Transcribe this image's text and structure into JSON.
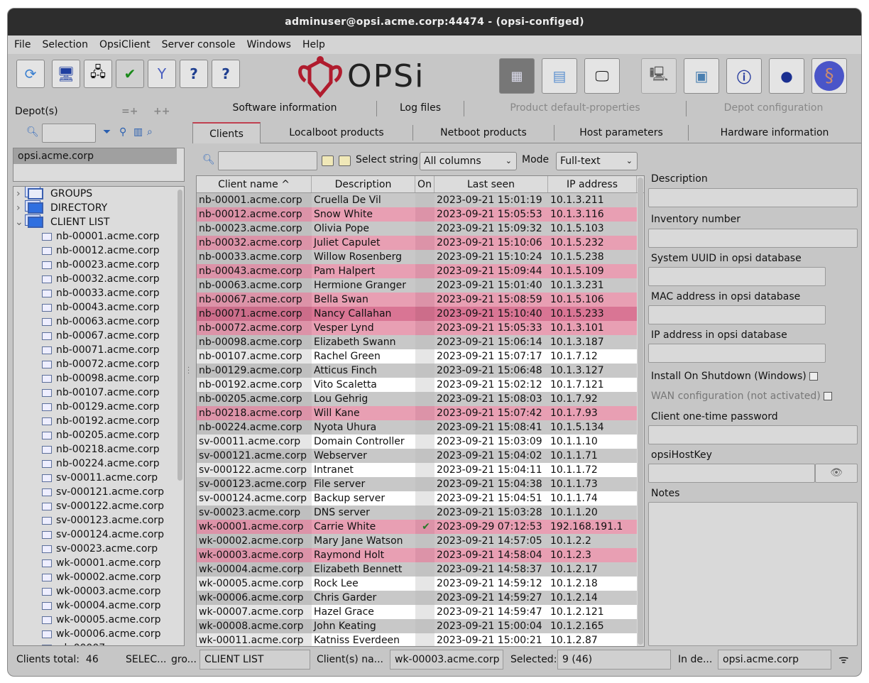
{
  "window": {
    "title": "adminuser@opsi.acme.corp:44474 - (opsi-configed)"
  },
  "menu": [
    "File",
    "Selection",
    "OpsiClient",
    "Server console",
    "Windows",
    "Help"
  ],
  "logo": "OPSi",
  "depot": {
    "label": "Depot(s)",
    "btn_a": "=+",
    "btn_b": "++",
    "selected": "opsi.acme.corp"
  },
  "tree": {
    "groups": [
      "GROUPS",
      "DIRECTORY",
      "CLIENT LIST"
    ]
  },
  "subtabs": [
    "Software information",
    "Log files",
    "Product default-properties",
    "Depot configuration"
  ],
  "tabs": [
    "Clients",
    "Localboot products",
    "Netboot products",
    "Host parameters",
    "Hardware information"
  ],
  "filter": {
    "select_label": "Select string",
    "columns": "All columns",
    "mode_label": "Mode",
    "mode": "Full-text"
  },
  "columns": [
    "Client name ^",
    "Description",
    "On",
    "Last seen",
    "IP address"
  ],
  "rows": [
    [
      "nb-00001.acme.corp",
      "Cruella De Vil",
      "",
      "2023-09-21 15:01:19",
      "10.1.3.211",
      "g"
    ],
    [
      "nb-00012.acme.corp",
      "Snow White",
      "",
      "2023-09-21 15:05:53",
      "10.1.3.116",
      "p"
    ],
    [
      "nb-00023.acme.corp",
      "Olivia Pope",
      "",
      "2023-09-21 15:09:32",
      "10.1.5.103",
      "g"
    ],
    [
      "nb-00032.acme.corp",
      "Juliet Capulet",
      "",
      "2023-09-21 15:10:06",
      "10.1.5.232",
      "p"
    ],
    [
      "nb-00033.acme.corp",
      "Willow Rosenberg",
      "",
      "2023-09-21 15:10:24",
      "10.1.5.238",
      "g"
    ],
    [
      "nb-00043.acme.corp",
      "Pam Halpert",
      "",
      "2023-09-21 15:09:44",
      "10.1.5.109",
      "p"
    ],
    [
      "nb-00063.acme.corp",
      "Hermione Granger",
      "",
      "2023-09-21 15:01:40",
      "10.1.3.231",
      "g"
    ],
    [
      "nb-00067.acme.corp",
      "Bella Swan",
      "",
      "2023-09-21 15:08:59",
      "10.1.5.106",
      "p"
    ],
    [
      "nb-00071.acme.corp",
      "Nancy Callahan",
      "",
      "2023-09-21 15:10:40",
      "10.1.5.233",
      "d"
    ],
    [
      "nb-00072.acme.corp",
      "Vesper Lynd",
      "",
      "2023-09-21 15:05:33",
      "10.1.3.101",
      "p"
    ],
    [
      "nb-00098.acme.corp",
      "Elizabeth Swann",
      "",
      "2023-09-21 15:06:14",
      "10.1.3.187",
      "g"
    ],
    [
      "nb-00107.acme.corp",
      "Rachel Green",
      "",
      "2023-09-21 15:07:17",
      "10.1.7.12",
      "w"
    ],
    [
      "nb-00129.acme.corp",
      "Atticus Finch",
      "",
      "2023-09-21 15:06:48",
      "10.1.3.127",
      "g"
    ],
    [
      "nb-00192.acme.corp",
      "Vito Scaletta",
      "",
      "2023-09-21 15:02:12",
      "10.1.7.121",
      "w"
    ],
    [
      "nb-00205.acme.corp",
      "Lou Gehrig",
      "",
      "2023-09-21 15:08:03",
      "10.1.7.92",
      "g"
    ],
    [
      "nb-00218.acme.corp",
      "Will Kane",
      "",
      "2023-09-21 15:07:42",
      "10.1.7.93",
      "p"
    ],
    [
      "nb-00224.acme.corp",
      "Nyota Uhura",
      "",
      "2023-09-21 15:08:41",
      "10.1.5.134",
      "g"
    ],
    [
      "sv-00011.acme.corp",
      "Domain Controller",
      "",
      "2023-09-21 15:03:09",
      "10.1.1.10",
      "w"
    ],
    [
      "sv-000121.acme.corp",
      "Webserver",
      "",
      "2023-09-21 15:04:02",
      "10.1.1.71",
      "g"
    ],
    [
      "sv-000122.acme.corp",
      "Intranet",
      "",
      "2023-09-21 15:04:11",
      "10.1.1.72",
      "w"
    ],
    [
      "sv-000123.acme.corp",
      "File server",
      "",
      "2023-09-21 15:04:38",
      "10.1.1.73",
      "g"
    ],
    [
      "sv-000124.acme.corp",
      "Backup server",
      "",
      "2023-09-21 15:04:51",
      "10.1.1.74",
      "w"
    ],
    [
      "sv-00023.acme.corp",
      "DNS server",
      "",
      "2023-09-21 15:03:28",
      "10.1.1.20",
      "g"
    ],
    [
      "wk-00001.acme.corp",
      "Carrie White",
      "✔",
      "2023-09-29 07:12:53",
      "192.168.191.1",
      "p"
    ],
    [
      "wk-00002.acme.corp",
      "Mary Jane Watson",
      "",
      "2023-09-21 14:57:05",
      "10.1.2.2",
      "g"
    ],
    [
      "wk-00003.acme.corp",
      "Raymond Holt",
      "",
      "2023-09-21 14:58:04",
      "10.1.2.3",
      "p"
    ],
    [
      "wk-00004.acme.corp",
      "Elizabeth Bennett",
      "",
      "2023-09-21 14:58:37",
      "10.1.2.17",
      "g"
    ],
    [
      "wk-00005.acme.corp",
      "Rock Lee",
      "",
      "2023-09-21 14:59:12",
      "10.1.2.18",
      "w"
    ],
    [
      "wk-00006.acme.corp",
      "Chris Garder",
      "",
      "2023-09-21 14:59:27",
      "10.1.2.14",
      "g"
    ],
    [
      "wk-00007.acme.corp",
      "Hazel Grace",
      "",
      "2023-09-21 14:59:47",
      "10.1.2.121",
      "w"
    ],
    [
      "wk-00008.acme.corp",
      "John Keating",
      "",
      "2023-09-21 15:00:04",
      "10.1.2.165",
      "g"
    ],
    [
      "wk-00011.acme.corp",
      "Katniss Everdeen",
      "",
      "2023-09-21 15:00:21",
      "10.1.2.87",
      "w"
    ]
  ],
  "details": {
    "description": "Description",
    "inventory": "Inventory number",
    "uuid": "System UUID in opsi database",
    "mac": "MAC address in opsi database",
    "ip": "IP address in opsi database",
    "shutdown": "Install On Shutdown (Windows)",
    "wan": "WAN configuration (not activated)",
    "otp": "Client one-time password",
    "hostkey": "opsiHostKey",
    "notes": "Notes"
  },
  "status": {
    "total_label": "Clients total:",
    "total": "46",
    "sel_label": "SELEC...",
    "grp_label": "gro...",
    "group": "CLIENT LIST",
    "names_label": "Client(s) na...",
    "names": "wk-00003.acme.corp",
    "selected_label": "Selected:",
    "selected": "9 (46)",
    "depot_label": "In de...",
    "depot": "opsi.acme.corp"
  }
}
